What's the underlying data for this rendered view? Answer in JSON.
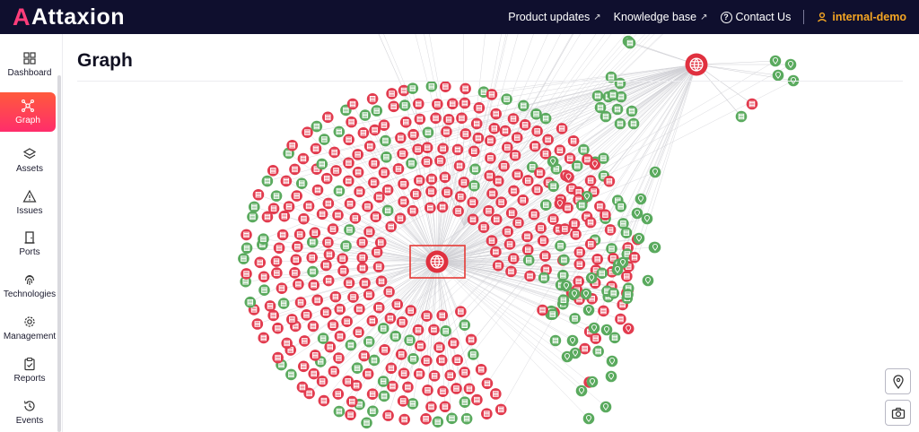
{
  "app": {
    "brand": "Attaxion"
  },
  "topnav": {
    "product_updates": "Product updates",
    "knowledge_base": "Knowledge base",
    "contact_us": "Contact Us",
    "org_name": "internal-demo"
  },
  "sidebar": {
    "items": [
      {
        "label": "Dashboard",
        "icon": "dashboard-icon"
      },
      {
        "label": "Graph",
        "icon": "graph-icon",
        "active": true
      },
      {
        "label": "Assets",
        "icon": "layers-icon"
      },
      {
        "label": "Issues",
        "icon": "warning-icon"
      },
      {
        "label": "Ports",
        "icon": "door-icon"
      },
      {
        "label": "Technologies",
        "icon": "fingerprint-icon"
      },
      {
        "label": "Management",
        "icon": "gear-icon"
      },
      {
        "label": "Reports",
        "icon": "clipboard-icon"
      },
      {
        "label": "Events",
        "icon": "history-icon"
      }
    ]
  },
  "page": {
    "title": "Graph"
  },
  "colors": {
    "topbar": "#0f0f2e",
    "accent_orange": "#f5a623",
    "node_red": "#e23b4e",
    "node_green": "#5aaa5e",
    "edge": "#cfcfd4",
    "highlight_box": "#e53935"
  },
  "controls": {
    "location_button_icon": "map-pin-icon",
    "screenshot_button_icon": "camera-icon"
  }
}
